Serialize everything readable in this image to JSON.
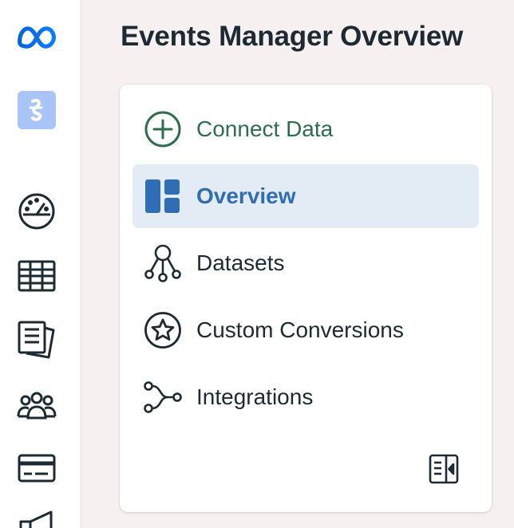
{
  "page": {
    "title": "Events Manager Overview"
  },
  "rail": {
    "items": [
      {
        "icon": "meta-logo-icon"
      },
      {
        "icon": "app-avatar-icon"
      },
      {
        "icon": "gauge-icon"
      },
      {
        "icon": "table-icon"
      },
      {
        "icon": "documents-icon"
      },
      {
        "icon": "people-icon"
      },
      {
        "icon": "credit-card-icon"
      },
      {
        "icon": "megaphone-icon"
      }
    ]
  },
  "nav": {
    "items": [
      {
        "label": "Connect Data",
        "icon": "plus-circle-icon",
        "state": "default"
      },
      {
        "label": "Overview",
        "icon": "dashboard-icon",
        "state": "selected"
      },
      {
        "label": "Datasets",
        "icon": "dataset-nodes-icon",
        "state": "default"
      },
      {
        "label": "Custom Conversions",
        "icon": "star-circle-icon",
        "state": "default"
      },
      {
        "label": "Integrations",
        "icon": "integration-flow-icon",
        "state": "default"
      }
    ],
    "collapse_icon": "collapse-panel-icon"
  },
  "colors": {
    "accent": "#2f6db6",
    "selected_bg": "#e3ecf5",
    "connect_green": "#2d6e4d",
    "text": "#1c2b33",
    "page_bg": "#f7f0f0",
    "meta_blue": "#0866ff"
  }
}
